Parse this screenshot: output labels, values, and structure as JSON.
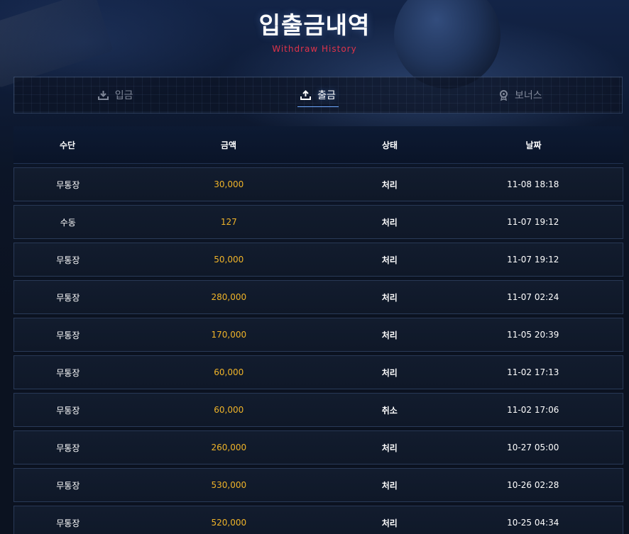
{
  "header": {
    "title": "입출금내역",
    "subtitle": "Withdraw History"
  },
  "tabs": [
    {
      "label": "입금",
      "icon": "download-icon",
      "active": false
    },
    {
      "label": "출금",
      "icon": "upload-icon",
      "active": true
    },
    {
      "label": "보너스",
      "icon": "award-icon",
      "active": false
    }
  ],
  "table": {
    "columns": [
      "수단",
      "금액",
      "상태",
      "날짜"
    ],
    "rows": [
      {
        "method": "무통장",
        "amount": "30,000",
        "status": "처리",
        "date": "11-08 18:18"
      },
      {
        "method": "수동",
        "amount": "127",
        "status": "처리",
        "date": "11-07 19:12"
      },
      {
        "method": "무통장",
        "amount": "50,000",
        "status": "처리",
        "date": "11-07 19:12"
      },
      {
        "method": "무통장",
        "amount": "280,000",
        "status": "처리",
        "date": "11-07 02:24"
      },
      {
        "method": "무통장",
        "amount": "170,000",
        "status": "처리",
        "date": "11-05 20:39"
      },
      {
        "method": "무통장",
        "amount": "60,000",
        "status": "처리",
        "date": "11-02 17:13"
      },
      {
        "method": "무통장",
        "amount": "60,000",
        "status": "취소",
        "date": "11-02 17:06"
      },
      {
        "method": "무통장",
        "amount": "260,000",
        "status": "처리",
        "date": "10-27 05:00"
      },
      {
        "method": "무통장",
        "amount": "530,000",
        "status": "처리",
        "date": "10-26 02:28"
      },
      {
        "method": "무통장",
        "amount": "520,000",
        "status": "처리",
        "date": "10-25 04:34"
      }
    ]
  },
  "colors": {
    "accent_amount": "#f0b429",
    "subtitle": "#e0334a",
    "active_tab_underline": "#6ea8ff"
  }
}
